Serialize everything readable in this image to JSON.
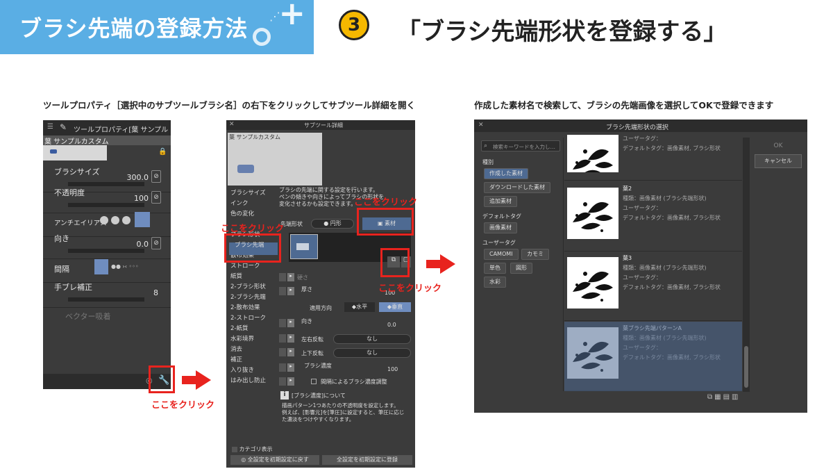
{
  "banner": {
    "title": "ブラシ先端の登録方法"
  },
  "step": {
    "number": "3",
    "title": "「ブラシ先端形状を登録する」"
  },
  "captions": {
    "left": "ツールプロパティ［選択中のサブツールブラシ名］の右下をクリックしてサブツール詳細を開く",
    "right": "作成した素材名で検索して、ブラシの先端画像を選択してOKで登録できます"
  },
  "callouts": {
    "click": "ここをクリック"
  },
  "tool_property": {
    "title": "ツールプロパティ[葉 サンプル",
    "preset_name": "葉 サンプルカスタム",
    "brush_size_label": "ブラシサイズ",
    "brush_size_value": "300.0",
    "opacity_label": "不透明度",
    "opacity_value": "100",
    "antialias_label": "アンチエイリアス",
    "direction_label": "向き",
    "direction_value": "0.0",
    "interval_label": "間隔",
    "stabilizer_label": "手ブレ補正",
    "stabilizer_value": "8",
    "vector_label": "ベクター吸着"
  },
  "subtool_detail": {
    "title": "サブツール詳細",
    "preset_name": "葉 サンプルカスタム",
    "nav": [
      "ブラシサイズ",
      "インク",
      "色の変化",
      "",
      "ブラシ形状",
      "ブラシ先端",
      "散布効果",
      "ストローク",
      "紙質",
      "2-ブラシ形状",
      "2-ブラシ先端",
      "2-散布効果",
      "2-ストローク",
      "2-紙質",
      "水彩境界",
      "消去",
      "補正",
      "入り抜き",
      "はみ出し防止"
    ],
    "description": "ブラシの先端に関する設定を行います。\nペンの傾きや向きによってブラシの形状を\n変化させるかも設定できます。",
    "tip_shape_label": "先端形状",
    "circle_label": "円形",
    "material_label": "素材",
    "hardness_label": "硬さ",
    "thickness_label": "厚さ",
    "thickness_value": "100",
    "apply_direction_label": "適用方向",
    "horizontal_label": "水平",
    "vertical_label": "垂直",
    "direction_label": "向き",
    "direction_value": "0.0",
    "flip_h_label": "左右反転",
    "flip_h_value": "なし",
    "flip_v_label": "上下反転",
    "flip_v_value": "なし",
    "density_label": "ブラシ濃度",
    "density_value": "100",
    "interval_density_label": "間隔によるブラシ濃度調整",
    "info_title": "[ブラシ濃度]について",
    "info_text": "描画パターン1つあたりの不透明度を設定します。\n例えば、[影響元]を[筆圧]に設定すると、筆圧に応じ\nた濃淡をつけやすくなります。",
    "category_label": "カテゴリ表示",
    "reset_button": "全設定を初期設定に戻す",
    "register_button": "全設定を初期設定に登録"
  },
  "tip_select": {
    "title": "ブラシ先端形状の選択",
    "search_placeholder": "検索キーワードを入力し…",
    "kind_label": "種別",
    "kind_tags": [
      "作成した素材",
      "ダウンロードした素材",
      "追加素材"
    ],
    "default_tag_label": "デフォルトタグ",
    "default_tags": [
      "画像素材"
    ],
    "user_tag_label": "ユーザータグ",
    "user_tags": [
      "CAMOMI",
      "カモミ",
      "単色",
      "図形",
      "水彩"
    ],
    "ok_label": "OK",
    "cancel_label": "キャンセル",
    "items": [
      {
        "name": "",
        "kind": "",
        "user_tag": "ユーザータグ：",
        "default_tag": "デフォルトタグ：画像素材, ブラシ形状"
      },
      {
        "name": "葉2",
        "kind": "種類：画像素材 (ブラシ先端形状)",
        "user_tag": "ユーザータグ：",
        "default_tag": "デフォルトタグ：画像素材, ブラシ形状"
      },
      {
        "name": "葉3",
        "kind": "種類：画像素材 (ブラシ先端形状)",
        "user_tag": "ユーザータグ：",
        "default_tag": "デフォルトタグ：画像素材, ブラシ形状"
      },
      {
        "name": "葉ブラシ先端パターンA",
        "kind": "種類：画像素材 (ブラシ先端形状)",
        "user_tag": "ユーザータグ：",
        "default_tag": "デフォルトタグ：画像素材, ブラシ形状"
      }
    ]
  },
  "colors": {
    "banner": "#5aaee4",
    "callout": "#e8231e",
    "panel": "#3b3b3b",
    "selected": "#4e6a92"
  }
}
